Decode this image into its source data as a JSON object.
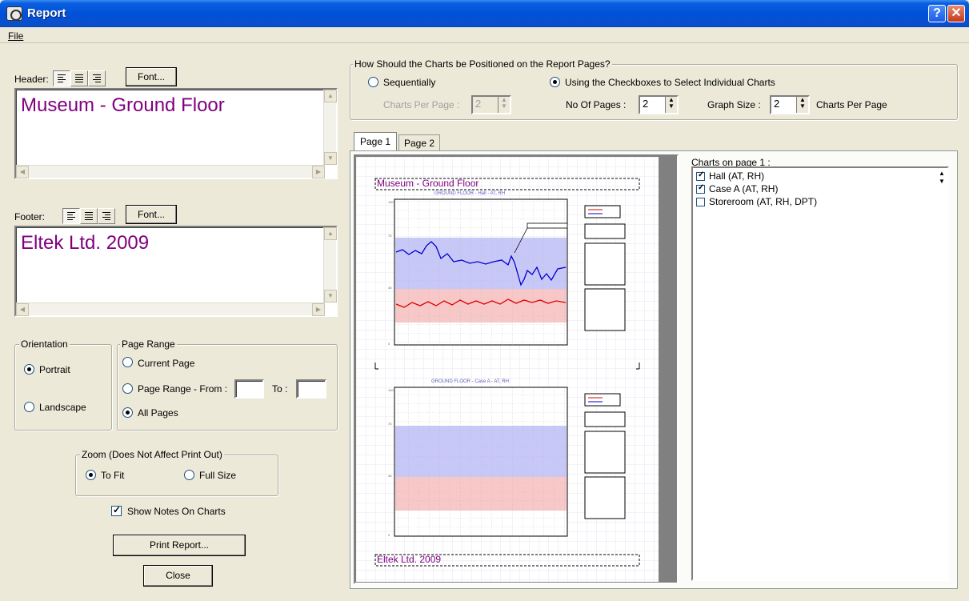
{
  "window": {
    "title": "Report",
    "help": "?",
    "close": "X"
  },
  "menu": {
    "file": "File"
  },
  "header": {
    "label": "Header:",
    "font_button": "Font...",
    "text": "Museum - Ground Floor"
  },
  "footer": {
    "label": "Footer:",
    "font_button": "Font...",
    "text": "Eltek Ltd. 2009"
  },
  "orientation": {
    "title": "Orientation",
    "portrait": "Portrait",
    "landscape": "Landscape",
    "selected": "Portrait"
  },
  "page_range": {
    "title": "Page Range",
    "current": "Current Page",
    "range_from": "Page Range - From :",
    "to": "To :",
    "from_value": "",
    "to_value": "",
    "all": "All Pages",
    "selected": "All Pages"
  },
  "zoom": {
    "title": "Zoom (Does Not Affect Print Out)",
    "to_fit": "To Fit",
    "full_size": "Full Size",
    "selected": "To Fit"
  },
  "show_notes": {
    "label": "Show Notes On Charts",
    "checked": true
  },
  "buttons": {
    "print": "Print Report...",
    "close": "Close"
  },
  "positioning": {
    "title": "How Should the Charts be Positioned on the Report Pages?",
    "sequentially": "Sequentially",
    "checkboxes": "Using the Checkboxes to Select Individual Charts",
    "selected": "Using the Checkboxes to Select Individual Charts",
    "charts_per_page_label": "Charts Per Page :",
    "charts_per_page": "2",
    "no_of_pages_label": "No Of Pages :",
    "no_of_pages": "2",
    "graph_size_label": "Graph Size :",
    "graph_size": "2",
    "graph_size_suffix": "Charts Per Page"
  },
  "tabs": [
    {
      "label": "Page 1",
      "active": true
    },
    {
      "label": "Page 2",
      "active": false
    }
  ],
  "preview": {
    "header_text": "Museum - Ground Floor",
    "footer_text": "Eltek Ltd. 2009",
    "chart1_title": "GROUND FLOOR - Hall - AT, RH",
    "chart2_title": "GROUND FLOOR - Case A - AT, RH"
  },
  "charts_list": {
    "label": "Charts on page 1 :",
    "items": [
      {
        "label": "Hall (AT, RH)",
        "checked": true
      },
      {
        "label": "Case A (AT, RH)",
        "checked": true
      },
      {
        "label": "Storeroom (AT, RH, DPT)",
        "checked": false
      }
    ]
  },
  "colors": {
    "titlebar": "#0150d8",
    "rich_text": "#800080",
    "rh_band": "#c8c8f8",
    "at_band": "#f8c8c8",
    "rh_line": "#0000d0",
    "at_line": "#e00000"
  }
}
